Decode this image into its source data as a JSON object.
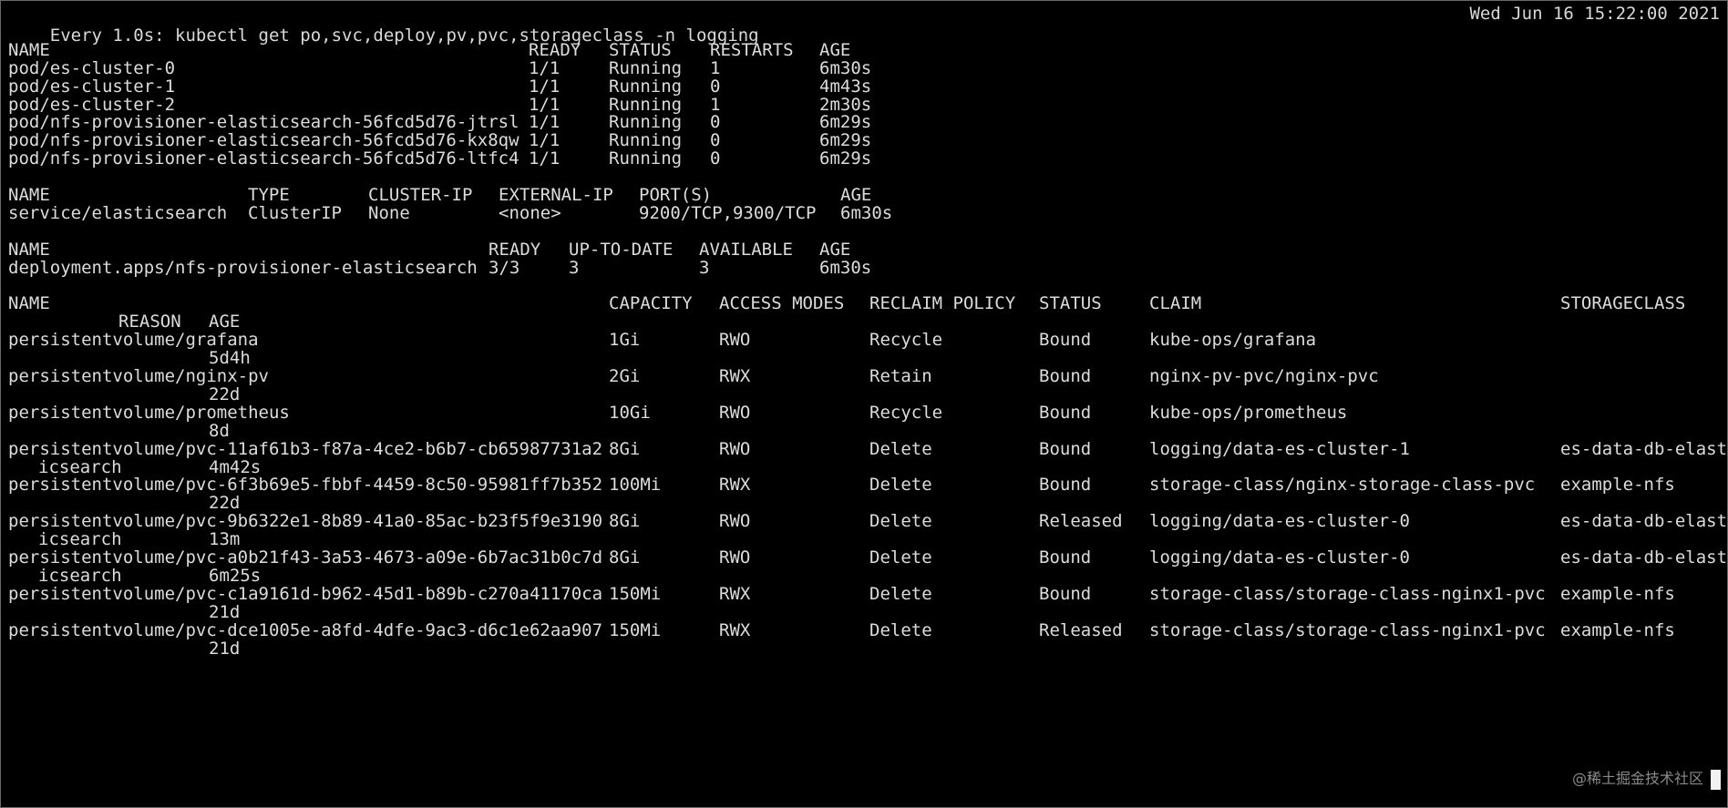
{
  "header": {
    "command": "Every 1.0s: kubectl get po,svc,deploy,pv,pvc,storageclass -n logging",
    "clock": "Wed Jun 16 15:22:00 2021"
  },
  "pods": {
    "headers": [
      "NAME",
      "READY",
      "STATUS",
      "RESTARTS",
      "AGE"
    ],
    "rows": [
      [
        "pod/es-cluster-0",
        "1/1",
        "Running",
        "1",
        "6m30s"
      ],
      [
        "pod/es-cluster-1",
        "1/1",
        "Running",
        "0",
        "4m43s"
      ],
      [
        "pod/es-cluster-2",
        "1/1",
        "Running",
        "1",
        "2m30s"
      ],
      [
        "pod/nfs-provisioner-elasticsearch-56fcd5d76-jtrsl",
        "1/1",
        "Running",
        "0",
        "6m29s"
      ],
      [
        "pod/nfs-provisioner-elasticsearch-56fcd5d76-kx8qw",
        "1/1",
        "Running",
        "0",
        "6m29s"
      ],
      [
        "pod/nfs-provisioner-elasticsearch-56fcd5d76-ltfc4",
        "1/1",
        "Running",
        "0",
        "6m29s"
      ]
    ]
  },
  "services": {
    "headers": [
      "NAME",
      "TYPE",
      "CLUSTER-IP",
      "EXTERNAL-IP",
      "PORT(S)",
      "AGE"
    ],
    "rows": [
      [
        "service/elasticsearch",
        "ClusterIP",
        "None",
        "<none>",
        "9200/TCP,9300/TCP",
        "6m30s"
      ]
    ]
  },
  "deployments": {
    "headers": [
      "NAME",
      "READY",
      "UP-TO-DATE",
      "AVAILABLE",
      "AGE"
    ],
    "rows": [
      [
        "deployment.apps/nfs-provisioner-elasticsearch",
        "3/3",
        "3",
        "3",
        "6m30s"
      ]
    ]
  },
  "pvs": {
    "headers": [
      "NAME",
      "CAPACITY",
      "ACCESS MODES",
      "RECLAIM POLICY",
      "STATUS",
      "CLAIM",
      "STORAGECLASS"
    ],
    "headers2": [
      "REASON",
      "AGE"
    ],
    "rows": [
      {
        "name": "persistentvolume/grafana",
        "capacity": "1Gi",
        "access": "RWO",
        "policy": "Recycle",
        "status": "Bound",
        "claim": "kube-ops/grafana",
        "sc": "",
        "wrap": "",
        "age": "5d4h"
      },
      {
        "name": "persistentvolume/nginx-pv",
        "capacity": "2Gi",
        "access": "RWX",
        "policy": "Retain",
        "status": "Bound",
        "claim": "nginx-pv-pvc/nginx-pvc",
        "sc": "",
        "wrap": "",
        "age": "22d"
      },
      {
        "name": "persistentvolume/prometheus",
        "capacity": "10Gi",
        "access": "RWO",
        "policy": "Recycle",
        "status": "Bound",
        "claim": "kube-ops/prometheus",
        "sc": "",
        "wrap": "",
        "age": "8d"
      },
      {
        "name": "persistentvolume/pvc-11af61b3-f87a-4ce2-b6b7-cb65987731a2",
        "capacity": "8Gi",
        "access": "RWO",
        "policy": "Delete",
        "status": "Bound",
        "claim": "logging/data-es-cluster-1",
        "sc": "es-data-db-elast",
        "wrap": "icsearch",
        "age": "4m42s"
      },
      {
        "name": "persistentvolume/pvc-6f3b69e5-fbbf-4459-8c50-95981ff7b352",
        "capacity": "100Mi",
        "access": "RWX",
        "policy": "Delete",
        "status": "Bound",
        "claim": "storage-class/nginx-storage-class-pvc",
        "sc": "example-nfs",
        "wrap": "",
        "age": "22d"
      },
      {
        "name": "persistentvolume/pvc-9b6322e1-8b89-41a0-85ac-b23f5f9e3190",
        "capacity": "8Gi",
        "access": "RWO",
        "policy": "Delete",
        "status": "Released",
        "claim": "logging/data-es-cluster-0",
        "sc": "es-data-db-elast",
        "wrap": "icsearch",
        "age": "13m"
      },
      {
        "name": "persistentvolume/pvc-a0b21f43-3a53-4673-a09e-6b7ac31b0c7d",
        "capacity": "8Gi",
        "access": "RWO",
        "policy": "Delete",
        "status": "Bound",
        "claim": "logging/data-es-cluster-0",
        "sc": "es-data-db-elast",
        "wrap": "icsearch",
        "age": "6m25s"
      },
      {
        "name": "persistentvolume/pvc-c1a9161d-b962-45d1-b89b-c270a41170ca",
        "capacity": "150Mi",
        "access": "RWX",
        "policy": "Delete",
        "status": "Bound",
        "claim": "storage-class/storage-class-nginx1-pvc",
        "sc": "example-nfs",
        "wrap": "",
        "age": "21d"
      },
      {
        "name": "persistentvolume/pvc-dce1005e-a8fd-4dfe-9ac3-d6c1e62aa907",
        "capacity": "150Mi",
        "access": "RWX",
        "policy": "Delete",
        "status": "Released",
        "claim": "storage-class/storage-class-nginx1-pvc",
        "sc": "example-nfs",
        "wrap": "",
        "age": "21d"
      }
    ]
  },
  "watermark": "@稀土掘金技术社区"
}
